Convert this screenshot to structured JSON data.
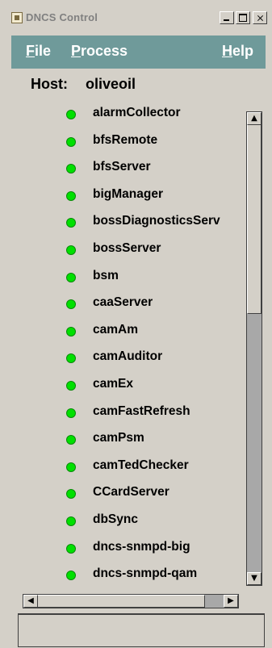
{
  "window": {
    "title": "DNCS Control"
  },
  "menu": {
    "file": {
      "first": "F",
      "rest": "ile"
    },
    "process": {
      "first": "P",
      "rest": "rocess"
    },
    "help": {
      "first": "H",
      "rest": "elp"
    }
  },
  "host": {
    "label": "Host:",
    "value": "oliveoil"
  },
  "processes": [
    {
      "name": "alarmCollector",
      "status": "running",
      "status_color": "#00e000"
    },
    {
      "name": "bfsRemote",
      "status": "running",
      "status_color": "#00e000"
    },
    {
      "name": "bfsServer",
      "status": "running",
      "status_color": "#00e000"
    },
    {
      "name": "bigManager",
      "status": "running",
      "status_color": "#00e000"
    },
    {
      "name": "bossDiagnosticsServ",
      "status": "running",
      "status_color": "#00e000"
    },
    {
      "name": "bossServer",
      "status": "running",
      "status_color": "#00e000"
    },
    {
      "name": "bsm",
      "status": "running",
      "status_color": "#00e000"
    },
    {
      "name": "caaServer",
      "status": "running",
      "status_color": "#00e000"
    },
    {
      "name": "camAm",
      "status": "running",
      "status_color": "#00e000"
    },
    {
      "name": "camAuditor",
      "status": "running",
      "status_color": "#00e000"
    },
    {
      "name": "camEx",
      "status": "running",
      "status_color": "#00e000"
    },
    {
      "name": "camFastRefresh",
      "status": "running",
      "status_color": "#00e000"
    },
    {
      "name": "camPsm",
      "status": "running",
      "status_color": "#00e000"
    },
    {
      "name": "camTedChecker",
      "status": "running",
      "status_color": "#00e000"
    },
    {
      "name": "CCardServer",
      "status": "running",
      "status_color": "#00e000"
    },
    {
      "name": "dbSync",
      "status": "running",
      "status_color": "#00e000"
    },
    {
      "name": "dncs-snmpd-big",
      "status": "running",
      "status_color": "#00e000"
    },
    {
      "name": "dncs-snmpd-qam",
      "status": "running",
      "status_color": "#00e000"
    }
  ],
  "colors": {
    "menubar": "#6f9a9a",
    "window": "#d4d0c8",
    "running": "#00e000"
  },
  "icons": {
    "app": "app-icon",
    "minimize": "minimize-icon",
    "maximize": "maximize-icon",
    "close": "close-icon"
  }
}
